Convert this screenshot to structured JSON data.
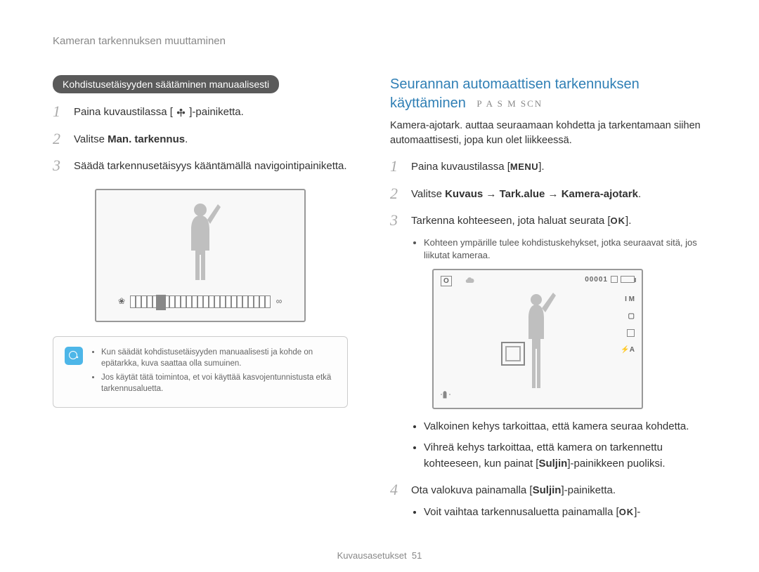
{
  "breadcrumb": "Kameran tarkennuksen muuttaminen",
  "left": {
    "pill": "Kohdistusetäisyyden säätäminen manuaalisesti",
    "step1_a": "Paina kuvaustilassa [",
    "step1_b": "]-painiketta.",
    "step2_a": "Valitse ",
    "step2_b": "Man. tarkennus",
    "step2_c": ".",
    "step3": "Säädä tarkennusetäisyys kääntämällä navigointipainiketta.",
    "note1": "Kun säädät kohdistusetäisyyden manuaalisesti ja kohde on epätarkka, kuva saattaa olla sumuinen.",
    "note2": "Jos käytät tätä toimintoa, et voi käyttää kasvojentunnistusta etkä tarkennusaluetta.",
    "focus_left_glyph": "❀",
    "focus_right_glyph": "∞"
  },
  "right": {
    "title": "Seurannan automaattisen tarkennuksen käyttäminen",
    "modes": "P A S M SCN",
    "intro": "Kamera-ajotark. auttaa seuraamaan kohdetta ja tarkentamaan siihen automaattisesti, jopa kun olet liikkeessä.",
    "step1_a": "Paina kuvaustilassa [",
    "step1_menu": "MENU",
    "step1_b": "].",
    "step2_a": "Valitse ",
    "step2_b": "Kuvaus",
    "step2_arrow": " → ",
    "step2_c": "Tark.alue",
    "step2_d": "Kamera-ajotark",
    "step2_e": ".",
    "step3_a": "Tarkenna kohteeseen, jota haluat seurata [",
    "step3_ok": "OK",
    "step3_b": "].",
    "sub1": "Kohteen ympärille tulee kohdistuskehykset, jotka seuraavat sitä, jos liikutat kameraa.",
    "bul1": "Valkoinen kehys tarkoittaa, että kamera seuraa kohdetta.",
    "bul2_a": "Vihreä kehys tarkoittaa, että kamera on tarkennettu kohteeseen, kun painat [",
    "bul2_b": "Suljin",
    "bul2_c": "]-painikkeen puoliksi.",
    "step4_a": "Ota valokuva painamalla [",
    "step4_b": "Suljin",
    "step4_c": "]-painiketta.",
    "sub4_a": "Voit vaihtaa tarkennusaluetta painamalla [",
    "sub4_ok": "OK",
    "sub4_b": "]-",
    "lcd_counter": "00001",
    "lcd_tl": "O",
    "lcd_r1": "I M",
    "lcd_r2": "▢",
    "lcd_r4": "⚡A"
  },
  "footer_label": "Kuvausasetukset",
  "footer_page": "51"
}
